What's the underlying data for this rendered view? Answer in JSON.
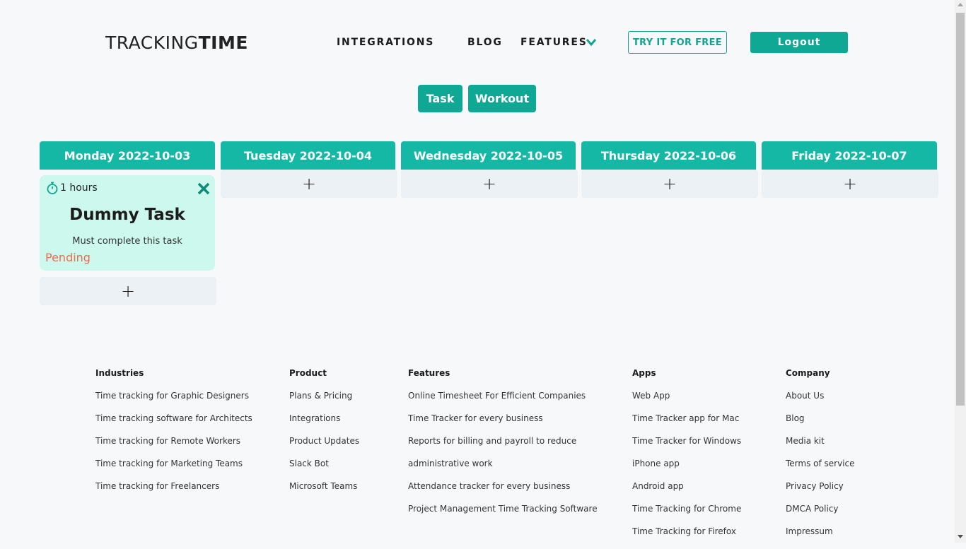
{
  "header": {
    "logo_light": "TRACKING",
    "logo_bold": "TIME",
    "nav": {
      "integrations": "INTEGRATIONS",
      "blog": "BLOG",
      "features": "FEATURES"
    },
    "try_button": "TRY IT FOR FREE",
    "logout_button": "Logout",
    "accent_color": "#0fa894"
  },
  "toggles": {
    "task": "Task",
    "workout": "Workout"
  },
  "days": [
    {
      "label": "Monday 2022-10-03"
    },
    {
      "label": "Tuesday 2022-10-04"
    },
    {
      "label": "Wednesday 2022-10-05"
    },
    {
      "label": "Thursday 2022-10-06"
    },
    {
      "label": "Friday 2022-10-07"
    }
  ],
  "add_symbol": "+",
  "task": {
    "hours": "1 hours",
    "title": "Dummy Task",
    "description": "Must complete this task",
    "status": "Pending",
    "status_color": "#ee6b4d",
    "icon": "timer-icon",
    "close_icon": "close-icon"
  },
  "footer": {
    "industries": {
      "heading": "Industries",
      "items": [
        "Time tracking for Graphic Designers",
        "Time tracking software for Architects",
        "Time tracking for Remote Workers",
        "Time tracking for Marketing Teams",
        "Time tracking for Freelancers"
      ]
    },
    "product": {
      "heading": "Product",
      "items": [
        "Plans & Pricing",
        "Integrations",
        "Product Updates",
        "Slack Bot",
        "Microsoft Teams"
      ]
    },
    "features": {
      "heading": "Features",
      "items": [
        "Online Timesheet For Efficient Companies",
        "Time Tracker for every business",
        "Reports for billing and payroll to reduce",
        "administrative work",
        "Attendance tracker for every business",
        "Project Management Time Tracking Software"
      ]
    },
    "apps": {
      "heading": "Apps",
      "items": [
        "Web App",
        "Time Tracker app for Mac",
        "Time Tracker for Windows",
        "iPhone app",
        "Android app",
        "Time Tracking for Chrome",
        "Time Tracking for Firefox"
      ]
    },
    "company": {
      "heading": "Company",
      "items": [
        "About Us",
        "Blog",
        "Media kit",
        "Terms of service",
        "Privacy Policy",
        "DMCA Policy",
        "Impressum"
      ]
    }
  }
}
